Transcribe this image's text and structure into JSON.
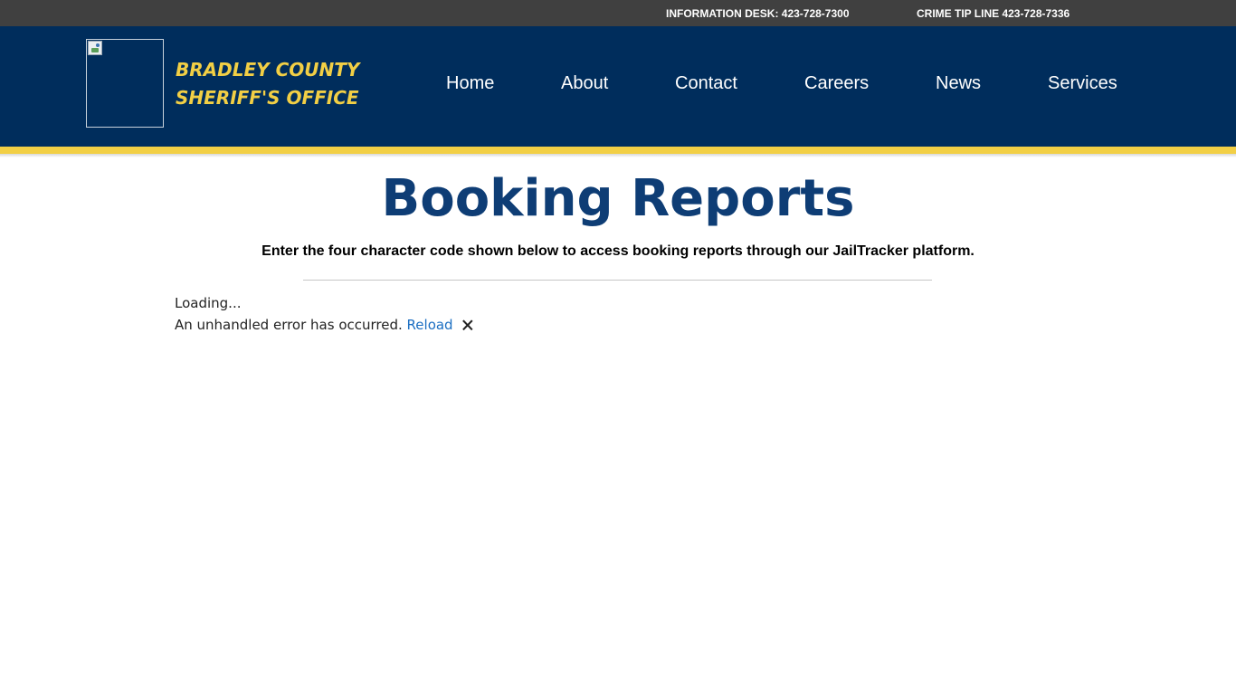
{
  "topbar": {
    "information_desk": "INFORMATION DESK: 423-728-7300",
    "crime_tip_line": "CRIME TIP LINE 423-728-7336"
  },
  "header": {
    "org_name_line1": "BRADLEY COUNTY",
    "org_name_line2": "SHERIFF'S OFFICE",
    "nav": [
      {
        "label": "Home"
      },
      {
        "label": "About"
      },
      {
        "label": "Contact"
      },
      {
        "label": "Careers"
      },
      {
        "label": "News"
      },
      {
        "label": "Services"
      }
    ]
  },
  "colors": {
    "topbar_bg": "#404040",
    "header_bg": "#002d5c",
    "accent_gold": "#f2cf45",
    "title_blue": "#0e3d75",
    "link_blue": "#1b6ec2"
  },
  "main": {
    "title": "Booking Reports",
    "subtitle": "Enter the four character code shown below to access booking reports through our JailTracker platform.",
    "loading_text": "Loading...",
    "error_text": "An unhandled error has occurred.",
    "reload_label": "Reload",
    "dismiss_icon": "close-icon",
    "dismiss_glyph": "🗙"
  }
}
